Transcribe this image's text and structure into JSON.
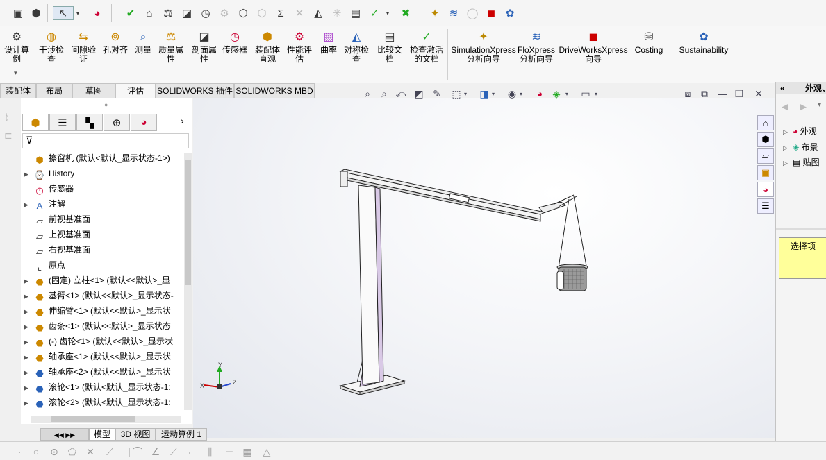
{
  "ribbon": {
    "buttons": [
      {
        "label": "设计算例",
        "icon": "design-study-icon"
      },
      {
        "label": "干涉检查",
        "icon": "interference-icon"
      },
      {
        "label": "间隙验证",
        "icon": "clearance-icon"
      },
      {
        "label": "孔对齐",
        "icon": "hole-align-icon"
      },
      {
        "label": "测量",
        "icon": "measure-icon"
      },
      {
        "label": "质量属性",
        "icon": "mass-properties-icon"
      },
      {
        "label": "剖面属性",
        "icon": "section-properties-icon"
      },
      {
        "label": "传感器",
        "icon": "sensor-icon"
      },
      {
        "label": "装配体直观",
        "icon": "assembly-visualization-icon"
      },
      {
        "label": "性能评估",
        "icon": "performance-icon"
      },
      {
        "label": "曲率",
        "icon": "curvature-icon"
      },
      {
        "label": "对称检查",
        "icon": "symmetry-icon"
      },
      {
        "label": "比较文档",
        "icon": "compare-icon"
      },
      {
        "label": "检查激活的文档",
        "icon": "check-doc-icon"
      },
      {
        "label": "SimulationXpress 分析向导",
        "icon": "simulationxpress-icon"
      },
      {
        "label": "FloXpress 分析向导",
        "icon": "floxpress-icon"
      },
      {
        "label": "DriveWorksXpress 向导",
        "icon": "driveworks-icon"
      },
      {
        "label": "Costing",
        "icon": "costing-icon"
      },
      {
        "label": "Sustainability",
        "icon": "sustainability-icon"
      }
    ]
  },
  "tabs": [
    "装配体",
    "布局",
    "草图",
    "评估",
    "SOLIDWORKS 插件",
    "SOLIDWORKS MBD"
  ],
  "tree": {
    "root": "擦窗机 (默认<默认_显示状态-1>)",
    "items": [
      {
        "label": "History",
        "exp": true
      },
      {
        "label": "传感器",
        "exp": false
      },
      {
        "label": "注解",
        "exp": true
      },
      {
        "label": "前视基准面",
        "exp": false
      },
      {
        "label": "上视基准面",
        "exp": false
      },
      {
        "label": "右视基准面",
        "exp": false
      },
      {
        "label": "原点",
        "exp": false
      },
      {
        "label": "(固定) 立柱<1> (默认<<默认>_显",
        "exp": true
      },
      {
        "label": "基臂<1> (默认<<默认>_显示状态-",
        "exp": true
      },
      {
        "label": "伸缩臂<1> (默认<<默认>_显示状",
        "exp": true
      },
      {
        "label": "齿条<1> (默认<<默认>_显示状态",
        "exp": true
      },
      {
        "label": "(-) 齿轮<1> (默认<<默认>_显示状",
        "exp": true
      },
      {
        "label": "轴承座<1> (默认<<默认>_显示状",
        "exp": true
      },
      {
        "label": "轴承座<2> (默认<<默认>_显示状",
        "exp": true
      },
      {
        "label": "滚轮<1> (默认<默认_显示状态-1:",
        "exp": true
      },
      {
        "label": "滚轮<2> (默认<默认_显示状态-1:",
        "exp": true
      }
    ]
  },
  "right_panel": {
    "header": "外观、",
    "items": [
      "外观",
      "布景",
      "贴图"
    ],
    "selection_label": "选择项"
  },
  "bottom_tabs": [
    "模型",
    "3D 视图",
    "运动算例 1"
  ],
  "triad": {
    "x": "X",
    "y": "Y",
    "z": "Z"
  },
  "colors": {
    "accent": "#2a62b8",
    "selection_yellow": "#ffff9a"
  }
}
